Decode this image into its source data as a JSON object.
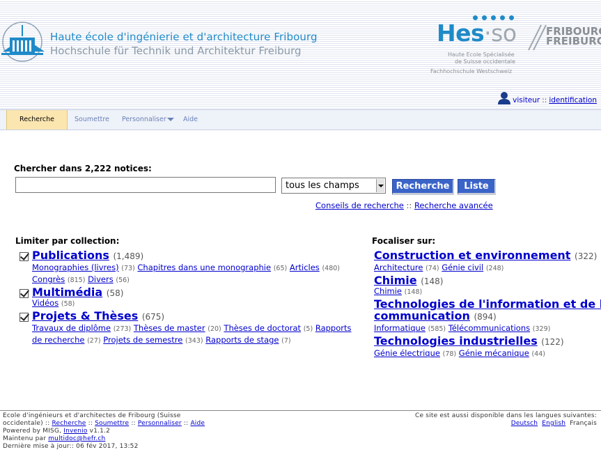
{
  "header": {
    "school_name_fr": "Haute école d'ingénierie et d'architecture Fribourg",
    "school_name_de": "Hochschule für Technik und Architektur Freiburg",
    "hes_so": {
      "hes": "Hes",
      "dot": "·",
      "so": "so",
      "fribourg1": "FRIBOURG",
      "fribourg2": "FREIBURG",
      "sub1": "Haute Ecole Spécialisée",
      "sub2": "de Suisse occidentale",
      "sub3": "Fachhochschule Westschweiz"
    },
    "user": {
      "visitor": "visiteur",
      "sep": "::",
      "login": "identification"
    }
  },
  "nav": {
    "tabs": [
      {
        "label": "Recherche",
        "active": true
      },
      {
        "label": "Soumettre"
      },
      {
        "label": "Personnaliser"
      },
      {
        "label": "Aide"
      }
    ]
  },
  "search": {
    "label": "Chercher dans 2,222 notices:",
    "input_value": "",
    "field_select": "tous les champs",
    "btn_search": "Recherche",
    "btn_list": "Liste",
    "link_tips": "Conseils de recherche",
    "sep": "::",
    "link_advanced": "Recherche avancée"
  },
  "limit": {
    "title": "Limiter par collection:",
    "collections": [
      {
        "name": "Publications",
        "count": "(1,489)",
        "line1": [
          {
            "name": "Monographies (livres)",
            "count": "(73)"
          },
          {
            "name": "Chapitres dans une monographie",
            "count": "(65)"
          },
          {
            "name": "Articles",
            "count": "(480)"
          }
        ],
        "line2": [
          {
            "name": "Congrès",
            "count": "(815)"
          },
          {
            "name": "Divers",
            "count": "(56)"
          }
        ]
      },
      {
        "name": "Multimédia",
        "count": "(58)",
        "line1": [
          {
            "name": "Vidéos",
            "count": "(58)"
          }
        ]
      },
      {
        "name": "Projets & Thèses",
        "count": "(675)",
        "line1": [
          {
            "name": "Travaux de diplôme",
            "count": "(273)"
          },
          {
            "name": "Thèses de master",
            "count": "(20)"
          },
          {
            "name": "Thèses de doctorat",
            "count": "(5)"
          },
          {
            "name": "Rapports",
            "count": ""
          }
        ],
        "line2": [
          {
            "name": "de recherche",
            "count": "(27)"
          },
          {
            "name": "Projets de semestre",
            "count": "(343)"
          },
          {
            "name": "Rapports de stage",
            "count": "(7)"
          }
        ]
      }
    ]
  },
  "focus": {
    "title": "Focaliser sur:",
    "groups": [
      {
        "name": "Construction et environnement",
        "count": "(322)",
        "subs": [
          {
            "name": "Architecture",
            "count": "(74)"
          },
          {
            "name": "Génie civil",
            "count": "(248)"
          }
        ]
      },
      {
        "name": "Chimie",
        "count": "(148)",
        "subs": [
          {
            "name": "Chimie",
            "count": "(148)"
          }
        ]
      },
      {
        "name_line1": "Technologies de l'information et de la",
        "name_line2": "communication",
        "count": "(894)",
        "subs": [
          {
            "name": "Informatique",
            "count": "(585)"
          },
          {
            "name": "Télécommunications",
            "count": "(329)"
          }
        ]
      },
      {
        "name": "Technologies industrielles",
        "count": "(122)",
        "subs": [
          {
            "name": "Génie électrique",
            "count": "(78)"
          },
          {
            "name": "Génie mécanique",
            "count": "(44)"
          }
        ]
      }
    ]
  },
  "footer": {
    "line1": "Ecole d'ingénieurs et d'architectes de Fribourg (Suisse",
    "line2_prefix": "occidentale) ::",
    "links": [
      "Recherche",
      "Soumettre",
      "Personnaliser",
      "Aide"
    ],
    "sep": "::",
    "powered_prefix": "Powered by MISG,",
    "powered_link": "Invenio",
    "powered_version": "v1.1.2",
    "maintained_prefix": "Maintenu par",
    "maintained_email": "multidoc@hefr.ch",
    "updated": "Dernière mise à jour:: 06 fév 2017, 13:52",
    "lang_text": "Ce site est aussi disponible dans les langues suivantes:",
    "lang_de": "Deutsch",
    "lang_en": "English",
    "lang_fr": "Français"
  }
}
